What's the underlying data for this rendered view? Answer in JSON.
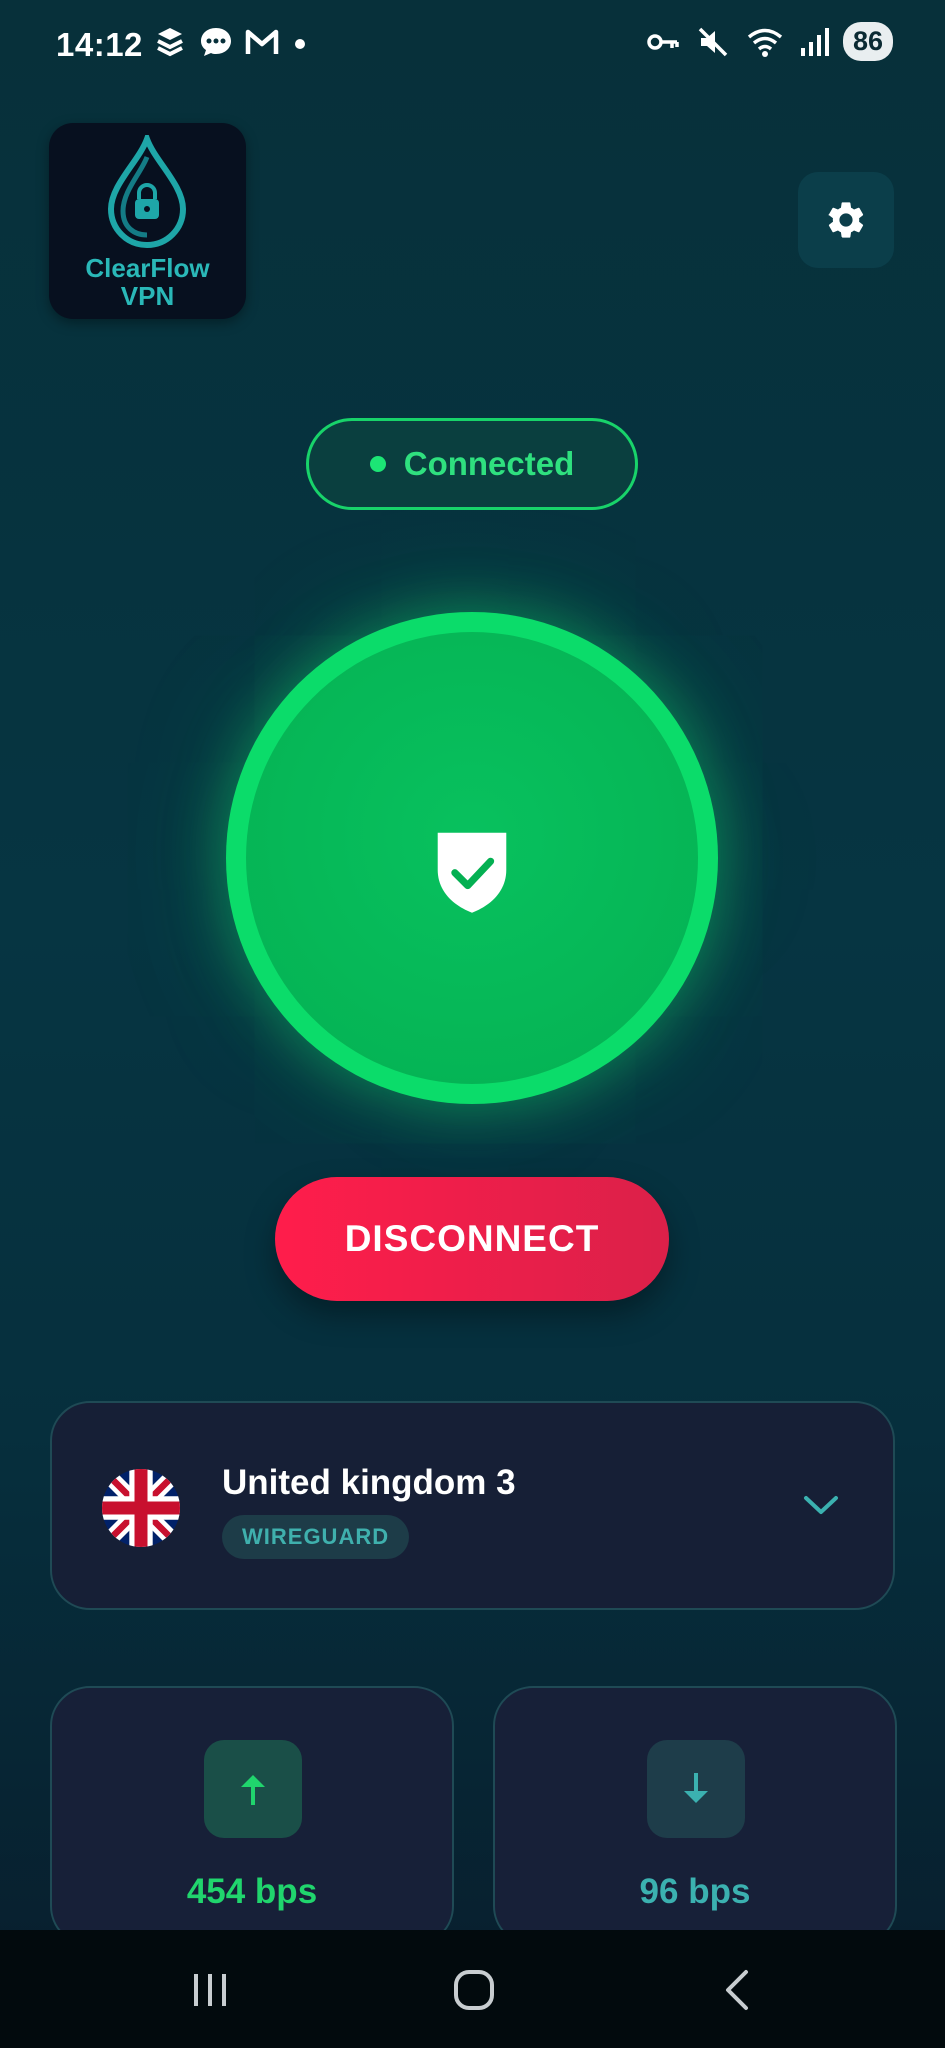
{
  "status_bar": {
    "time": "14:12",
    "battery": "86",
    "icons_left": [
      "stack-icon",
      "chat-icon",
      "gmail-icon",
      "dot-icon"
    ],
    "icons_right": [
      "vpn-key-icon",
      "mute-icon",
      "wifi-icon",
      "signal-icon"
    ]
  },
  "logo": {
    "line1": "ClearFlow",
    "line2": "VPN"
  },
  "connection": {
    "status": "Connected",
    "status_color": "#2fe07f"
  },
  "actions": {
    "disconnect_label": "DISCONNECT"
  },
  "server": {
    "name": "United kingdom 3",
    "protocol": "WIREGUARD",
    "flag": "uk-flag"
  },
  "stats": {
    "upload": {
      "value": "454 bps",
      "icon": "arrow-up-icon"
    },
    "download": {
      "value": "96 bps",
      "icon": "arrow-down-icon"
    }
  },
  "colors": {
    "accent_green": "#0bdc6a",
    "danger": "#ff1d4b",
    "teal": "#3bb1b0"
  }
}
